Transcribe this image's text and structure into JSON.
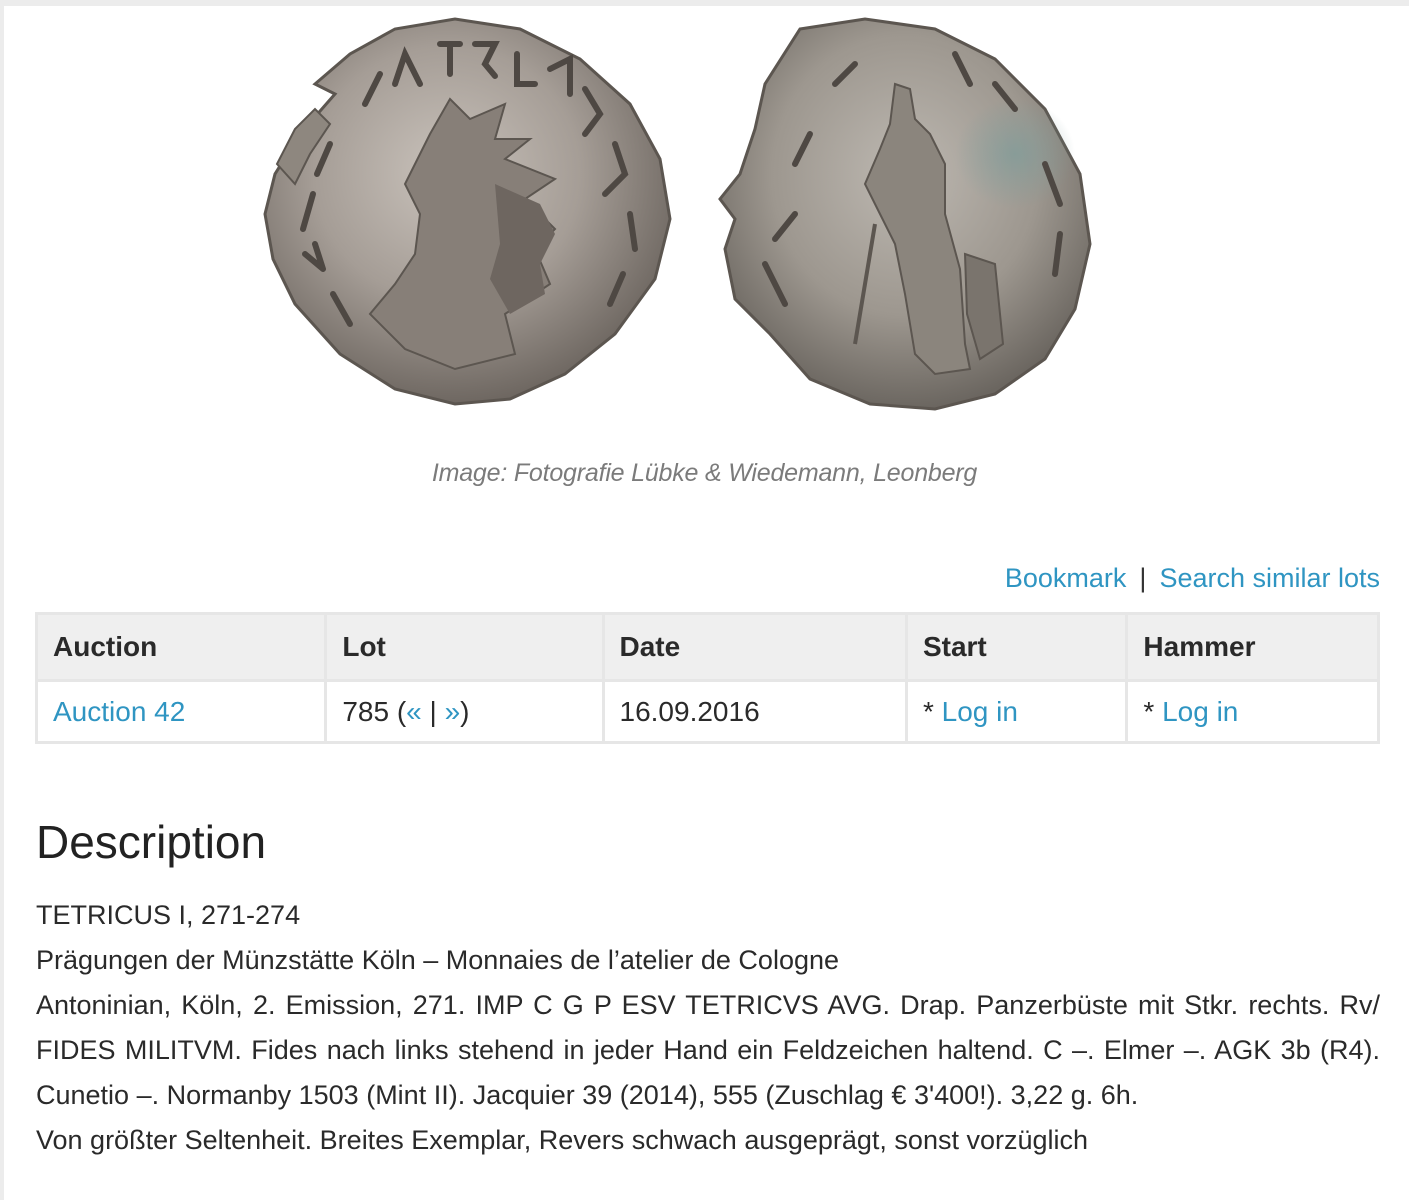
{
  "image": {
    "alt": "Antoninian of Tetricus I, obverse and reverse",
    "caption": "Image: Fotografie Lübke & Wiedemann, Leonberg"
  },
  "actions": {
    "bookmark": "Bookmark",
    "separator": "|",
    "search_similar": "Search similar lots"
  },
  "table": {
    "headers": [
      "Auction",
      "Lot",
      "Date",
      "Start",
      "Hammer"
    ],
    "row": {
      "auction": "Auction 42",
      "lot_number": "785",
      "lot_open": "(",
      "prev": "«",
      "lot_sep": "|",
      "next": "»",
      "lot_close": ")",
      "date": "16.09.2016",
      "start_prefix": "* ",
      "start_link": "Log in",
      "hammer_prefix": "* ",
      "hammer_link": "Log in"
    }
  },
  "description": {
    "title": "Description",
    "ruler": "TETRICUS I, 271-274",
    "section": "Prägungen der Münzstätte Köln – Monnaies de l’atelier de Cologne",
    "body": "Antoninian, Köln, 2. Emission, 271. IMP C G P ESV TETRICVS AVG. Drap. Panzerbüste mit Stkr. rechts. Rv/ FIDES MILITVM. Fides nach links stehend in jeder Hand ein Feldzeichen haltend. C –. Elmer –. AGK 3b (R4). Cunetio –. Normanby 1503 (Mint II). Jacquier 39 (2014), 555 (Zuschlag € 3'400!). 3,22 g. 6h.",
    "grade": "Von größter Seltenheit. Breites Exemplar, Revers schwach ausgeprägt, sonst vorzüglich"
  }
}
